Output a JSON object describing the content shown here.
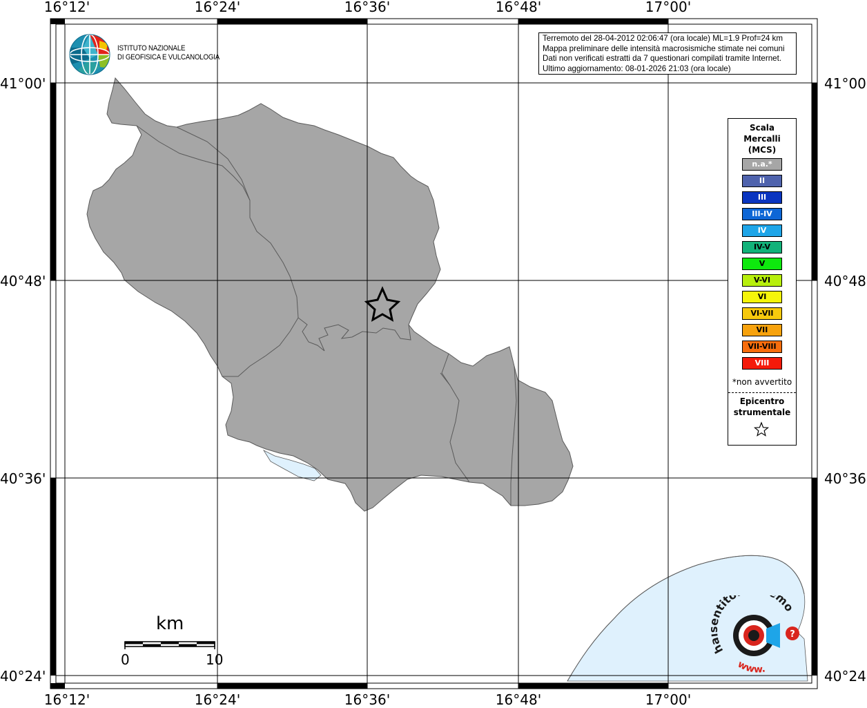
{
  "map": {
    "lon_labels": [
      "16°12'",
      "16°24'",
      "16°36'",
      "16°48'",
      "17°00'"
    ],
    "lat_labels": [
      "41°00'",
      "40°48'",
      "40°36'",
      "40°24'"
    ],
    "colors": {
      "land": "#a6a6a6",
      "water": "#dff1fd",
      "grid": "#000000",
      "border": "#5a5a5a"
    }
  },
  "info_box": {
    "line1": "Terremoto del 28-04-2012 02:06:47 (ora locale) ML=1.9 Prof=24 km",
    "line2": "Mappa preliminare delle intensità macrosismiche stimate nei comuni",
    "line3": "Dati non verificati estratti da 7 questionari compilati tramite Internet.",
    "line4": "Ultimo aggiornamento: 08-01-2026 21:03 (ora locale)"
  },
  "ingv": {
    "line1": "ISTITUTO NAZIONALE",
    "line2": "DI GEOFISICA E VULCANOLOGIA"
  },
  "legend": {
    "title_line1": "Scala",
    "title_line2": "Mercalli",
    "title_line3": "(MCS)",
    "items": [
      {
        "label": "n.a.*",
        "color": "#a6a6a6",
        "text_color": "#ffffff"
      },
      {
        "label": "II",
        "color": "#4f63ad",
        "text_color": "#ffffff"
      },
      {
        "label": "III",
        "color": "#0a35c0",
        "text_color": "#ffffff"
      },
      {
        "label": "III-IV",
        "color": "#0d66d6",
        "text_color": "#ffffff"
      },
      {
        "label": "IV",
        "color": "#1ea5e8",
        "text_color": "#ffffff"
      },
      {
        "label": "IV-V",
        "color": "#12b27a",
        "text_color": "#000000"
      },
      {
        "label": "V",
        "color": "#0ee80e",
        "text_color": "#000000"
      },
      {
        "label": "V-VI",
        "color": "#b7ef0d",
        "text_color": "#000000"
      },
      {
        "label": "VI",
        "color": "#f5f50a",
        "text_color": "#000000"
      },
      {
        "label": "VI-VII",
        "color": "#f7c90d",
        "text_color": "#000000"
      },
      {
        "label": "VII",
        "color": "#f7a20d",
        "text_color": "#000000"
      },
      {
        "label": "VII-VIII",
        "color": "#f76d0d",
        "text_color": "#000000"
      },
      {
        "label": "VIII",
        "color": "#f51a0a",
        "text_color": "#ffffff"
      }
    ],
    "note": "*non avvertito",
    "epi_line1": "Epicentro",
    "epi_line2": "strumentale",
    "epi_icon": "star-outline-icon"
  },
  "scale_bar": {
    "unit": "km",
    "start": "0",
    "end": "10"
  },
  "hst": {
    "text": "haisentitoilterremoto.it",
    "www": "www.",
    "icon": "target-logo-icon"
  }
}
